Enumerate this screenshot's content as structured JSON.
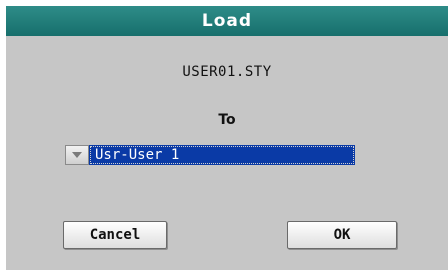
{
  "dialog": {
    "title": "Load",
    "filename": "USER01.STY",
    "to_label": "To",
    "destination": {
      "value": "Usr-User 1",
      "arrow_icon": "triangle-down-icon"
    },
    "buttons": {
      "cancel": "Cancel",
      "ok": "OK"
    }
  },
  "colors": {
    "titlebar": "#176f6c",
    "background": "#c6c6c6",
    "selection": "#0a3aa6"
  }
}
